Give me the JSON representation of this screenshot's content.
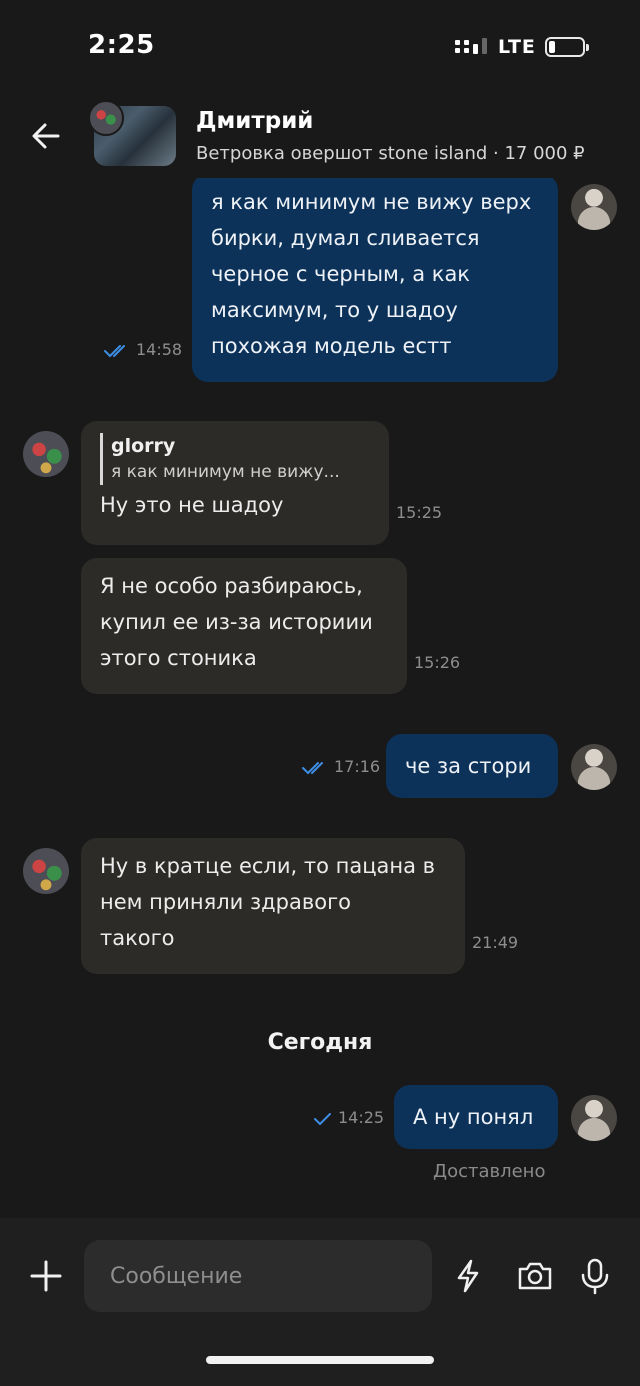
{
  "status_bar": {
    "time": "2:25",
    "network": "LTE",
    "battery_level": 0.2
  },
  "header": {
    "name": "Дмитрий",
    "subtitle": "Ветровка овершот stone island · 17 000 ₽"
  },
  "messages": [
    {
      "direction": "out",
      "lines": [
        "я как минимум не вижу верх",
        "бирки, думал сливается",
        "черное с черным, а как",
        "максимум, то у шадоу",
        "похожая модель естт"
      ],
      "time": "14:58",
      "status": "read"
    },
    {
      "direction": "in",
      "reply": {
        "name": "glorry",
        "text": "я как минимум не вижу..."
      },
      "lines": [
        "Ну это не шадоу"
      ],
      "time": "15:25"
    },
    {
      "direction": "in",
      "lines": [
        "Я не особо разбираюсь,",
        "купил ее из-за историии",
        "этого стоника"
      ],
      "time": "15:26"
    },
    {
      "direction": "out",
      "lines": [
        "че за стори"
      ],
      "time": "17:16",
      "status": "read"
    },
    {
      "direction": "in",
      "lines": [
        "Ну в кратце если, то пацана в",
        "нем приняли здравого",
        "такого"
      ],
      "time": "21:49"
    },
    {
      "direction": "out",
      "lines": [
        "А ну понял"
      ],
      "time": "14:25",
      "status": "sent"
    }
  ],
  "date_separator": "Сегодня",
  "delivered_label": "Доставлено",
  "composer": {
    "placeholder": "Сообщение"
  },
  "icons": {
    "back": "arrow-left-icon",
    "plus": "plus-icon",
    "lightning": "lightning-icon",
    "camera": "camera-icon",
    "mic": "microphone-icon"
  },
  "colors": {
    "outgoing_bubble": "#0c3259",
    "incoming_bubble": "#2d2b27",
    "read_check": "#3d8ee6"
  }
}
